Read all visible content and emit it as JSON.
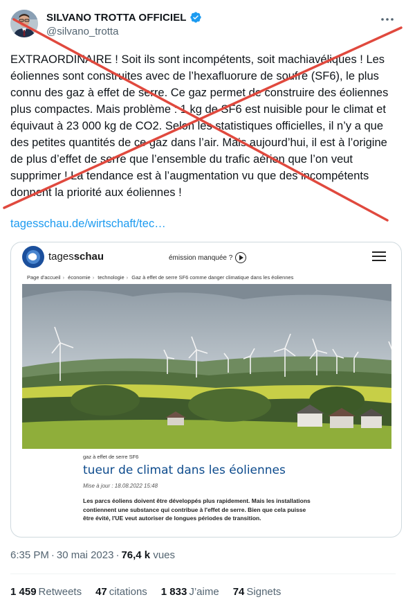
{
  "author": {
    "name": "SILVANO TROTTA OFFICIEL",
    "handle": "@silvano_trotta",
    "verified_color": "#1d9bf0"
  },
  "tweet": {
    "text": "EXTRAORDINAIRE ! Soit ils sont incompétents, soit machiavéliques ! Les éoliennes sont construites avec de l’hexafluorure de soufre (SF6), le plus connu des gaz à effet de serre. Ce gaz permet de construire des éoliennes plus compactes. Mais problème : 1 kg de SF6 est nuisible pour le climat et équivaut à 23 000 kg de CO2. Selon les statistiques officielles, il n’y a que des petites quantités de ce gaz dans l’air. Mais aujourd’hui, il est à l’origine de plus d’effet de serre que l’ensemble du trafic aérien que l’on veut supprimer ! La tendance est à l’augmentation vu que des incompétents donnent la priorité aux éoliennes !",
    "link": "tagesschau.de/wirtschaft/tec…",
    "cross_color": "#e0493e"
  },
  "card": {
    "site_name_light": "tages",
    "site_name_bold": "schau",
    "missed": "émission manquée ?",
    "breadcrumb": [
      "Page d'accueil",
      "économie",
      "technologie",
      "Gaz à effet de serre SF6 comme danger climatique dans les éoliennes"
    ],
    "kicker": "gaz à effet de serre SF6",
    "title": "tueur de climat dans les éoliennes",
    "date": "Mise à jour : 18.08.2022 15:48",
    "lead": "Les parcs éoliens doivent être développés plus rapidement. Mais les installations contiennent une substance qui contribue à l'effet de serre. Bien que cela puisse être évité, l'UE veut autoriser de longues périodes de transition."
  },
  "meta": {
    "time": "6:35 PM",
    "date": "30 mai 2023",
    "views_count": "76,4 k",
    "views_label": "vues"
  },
  "stats": [
    {
      "count": "1 459",
      "label": "Retweets"
    },
    {
      "count": "47",
      "label": "citations"
    },
    {
      "count": "1 833",
      "label": "J’aime"
    },
    {
      "count": "74",
      "label": "Signets"
    }
  ]
}
